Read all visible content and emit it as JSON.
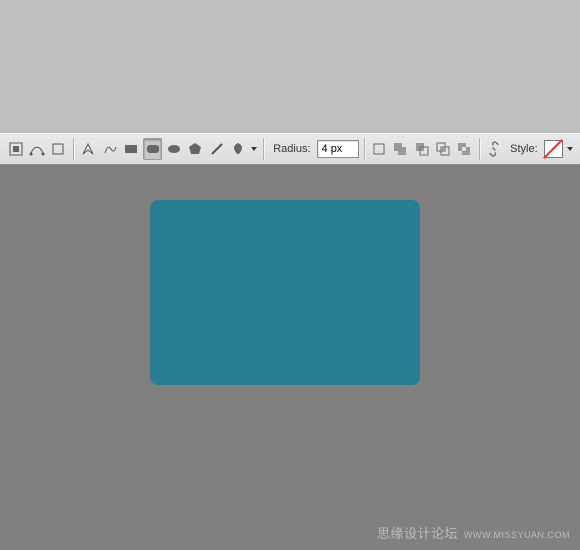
{
  "toolbar": {
    "radius_label": "Radius:",
    "radius_value": "4 px",
    "style_label": "Style:"
  },
  "icons": {
    "shape_layers": "shape-layers",
    "paths": "paths",
    "fill_pixels": "fill-pixels",
    "pen": "pen",
    "freeform_pen": "freeform-pen",
    "rectangle": "rectangle",
    "rounded_rect": "rounded-rectangle",
    "ellipse": "ellipse",
    "polygon": "polygon",
    "line": "line",
    "custom_shape": "custom-shape",
    "path_new": "new-path",
    "path_add": "add-to-path",
    "path_subtract": "subtract-path",
    "path_intersect": "intersect-path",
    "path_exclude": "exclude-path",
    "link": "link",
    "style_none": "no-style"
  },
  "shape": {
    "color": "#2a7e93",
    "corner_radius_px": 8
  },
  "watermark": {
    "text_cn": "思缘设计论坛",
    "url": "WWW.MISSYUAN.COM"
  }
}
